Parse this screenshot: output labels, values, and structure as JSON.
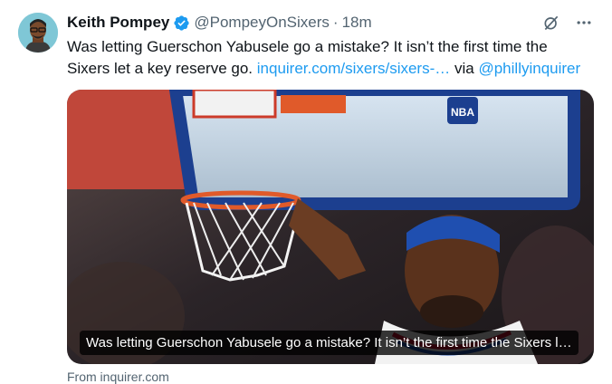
{
  "author": {
    "name": "Keith Pompey",
    "handle": "@PompeyOnSixers",
    "separator": "·",
    "time": "18m"
  },
  "tweet": {
    "text_main": "Was letting Guerschon Yabusele go a mistake? It isn’t the first time the Sixers let a key reserve go.",
    "link_text": "inquirer.com/sixers/sixers-…",
    "via_text": "via",
    "mention": "@phillyinquirer"
  },
  "card": {
    "caption": "Was letting Guerschon Yabusele go a mistake? It isn’t the first time the Sixers l…",
    "source": "From inquirer.com",
    "backboard_logo": "NBA"
  },
  "icons": {
    "verified": "verified-badge-icon",
    "grok": "grok-icon",
    "more": "more-icon"
  },
  "colors": {
    "link": "#1d9bf0",
    "secondary_text": "#536471",
    "verified": "#1d9bf0"
  }
}
